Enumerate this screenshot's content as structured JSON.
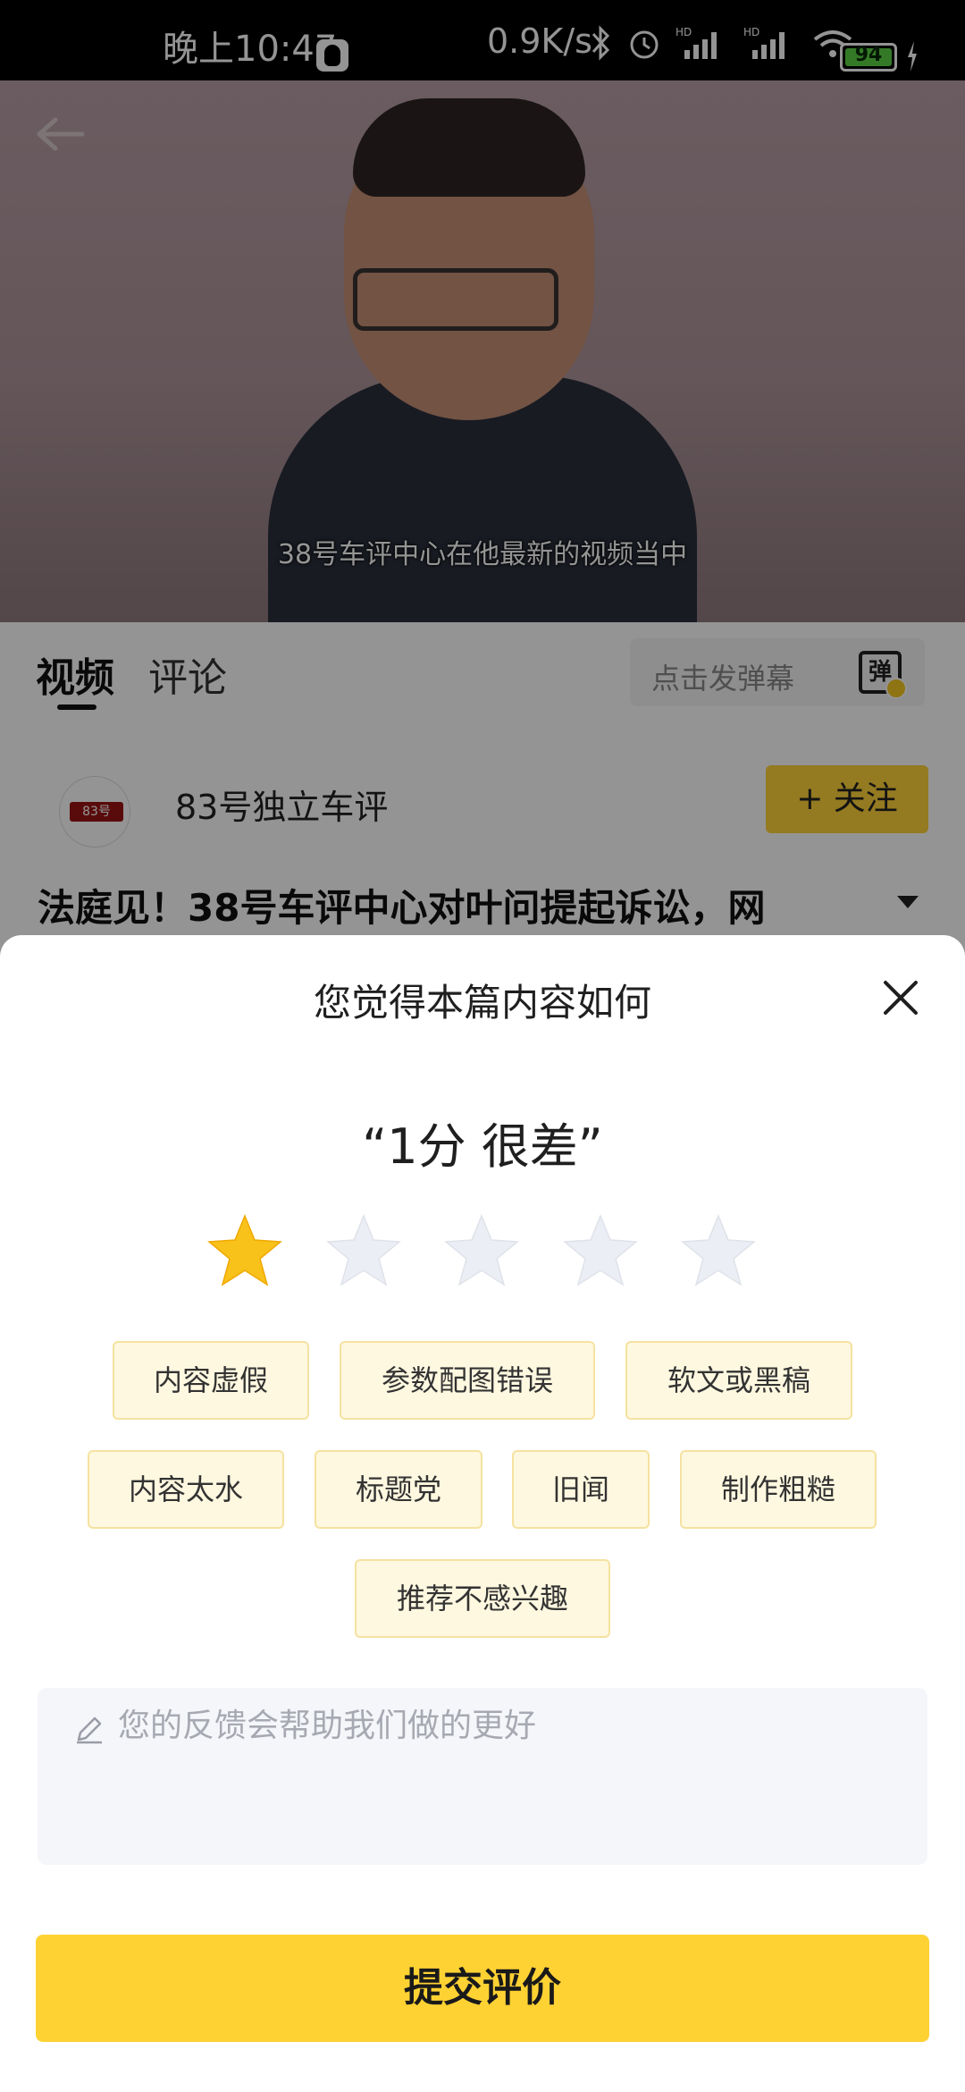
{
  "status_bar": {
    "time": "晚上10:47",
    "speed": "0.9K/s",
    "battery": "94",
    "battery_color": "#5ad243"
  },
  "video": {
    "subtitle": "38号车评中心在他最新的视频当中"
  },
  "tabs": [
    {
      "label": "视频",
      "active": true
    },
    {
      "label": "评论",
      "active": false
    }
  ],
  "danmaku": {
    "placeholder": "点击发弹幕",
    "icon_label": "弹"
  },
  "author": {
    "name": "83号独立车评",
    "logo_text": "83号",
    "follow_label": "+ 关注"
  },
  "article": {
    "title": "法庭见！38号车评中心对叶问提起诉讼，网"
  },
  "sheet": {
    "title": "您觉得本篇内容如何",
    "score_text": "“1分 很差”",
    "rating": 1,
    "rating_max": 5,
    "tags": [
      "内容虚假",
      "参数配图错误",
      "软文或黑稿",
      "内容太水",
      "标题党",
      "旧闻",
      "制作粗糙",
      "推荐不感兴趣"
    ],
    "feedback_placeholder": "您的反馈会帮助我们做的更好",
    "submit_label": "提交评价"
  },
  "colors": {
    "accent": "#ffd233",
    "tag_bg": "#fff8e0",
    "star_filled": "#f9c21a",
    "star_empty": "#eceef5"
  }
}
